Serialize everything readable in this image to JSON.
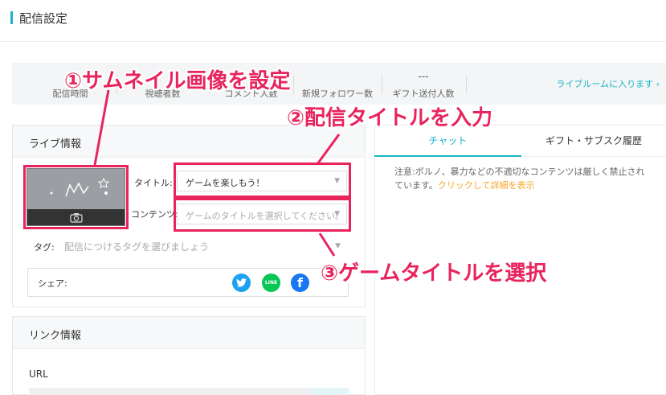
{
  "header": {
    "title": "配信設定"
  },
  "stats": {
    "items": [
      {
        "value": "",
        "label": "配信時間"
      },
      {
        "value": "",
        "label": "視聴者数"
      },
      {
        "value": "",
        "label": "コメント人数"
      },
      {
        "value": "",
        "label": "新規フォロワー数"
      },
      {
        "value": "---",
        "label": "ギフト送付人数"
      }
    ],
    "live_room_link": "ライブルームに入ります ›"
  },
  "live_info": {
    "heading": "ライブ情報",
    "title_label": "タイトル:",
    "title_value": "ゲームを楽しもう！",
    "content_label": "コンテンツ:",
    "content_placeholder": "ゲームのタイトルを選択してください。",
    "tag_label": "タグ:",
    "tag_placeholder": "配信につけるタグを選びましょう",
    "share_label": "シェア:",
    "share_icons": [
      "twitter-icon",
      "line-icon",
      "facebook-icon"
    ],
    "line_text": "LINE"
  },
  "link_info": {
    "heading": "リンク情報",
    "url_label": "URL"
  },
  "chat": {
    "tabs": [
      {
        "label": "チャット",
        "active": true
      },
      {
        "label": "ギフト・サブスク履歴",
        "active": false
      }
    ],
    "notice": "注意:ポルノ、暴力などの不適切なコンテンツは厳しく禁止されています。",
    "notice_link": "クリックして詳細を表示"
  },
  "annotations": {
    "a1": "①サムネイル画像を設定",
    "a2": "②配信タイトルを入力",
    "a3": "③ゲームタイトルを選択"
  },
  "colors": {
    "accent": "#1ab6c8",
    "annotation": "#e8245d",
    "link_orange": "#f5a623"
  }
}
